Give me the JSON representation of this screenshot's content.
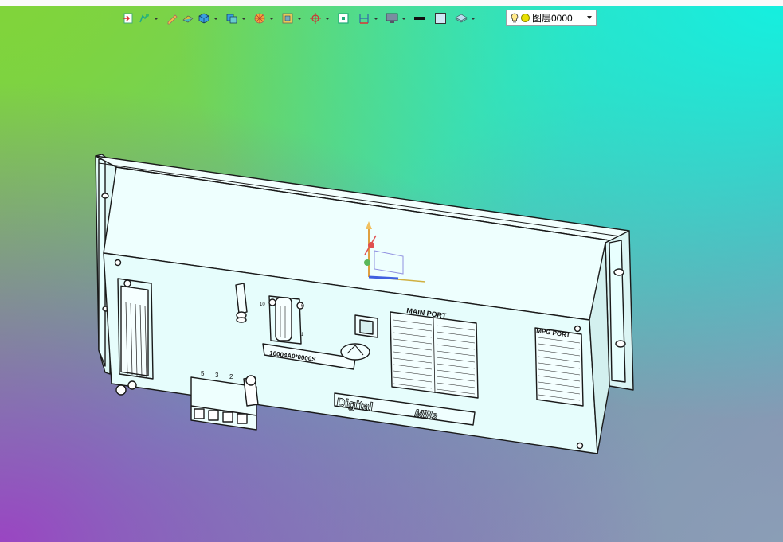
{
  "toolbar": {
    "icons": [
      "import-icon",
      "layer-add-icon",
      "pencil-icon",
      "eraser-block-icon",
      "cube-icon",
      "view-cube-icon",
      "render-wheel-icon",
      "section-box-icon",
      "axis-target-icon",
      "frame-icon",
      "dimension-icon",
      "monitor-icon",
      "line-color-swatch-icon",
      "fill-color-swatch-icon",
      "layers-stack-icon"
    ]
  },
  "layer_selector": {
    "value": "图层0000",
    "bulb_icon": "lightbulb-icon",
    "state_icon": "layer-state-icon"
  },
  "model": {
    "main_port_title": "MAIN PORT",
    "mpg_port_title": "MPG PORT",
    "serial_label": "10004A0*0000S",
    "brand_text": "Digital",
    "brand_suffix": "Mills",
    "pin_labels_top": [
      "5",
      "3",
      "2"
    ],
    "connector_labels": [
      "10",
      "6",
      "1"
    ]
  },
  "colors": {
    "model_fill": "#e8fffe",
    "model_stroke": "#1a1a1a",
    "accent_green": "#7ccf50",
    "accent_cyan": "#14f0e0",
    "accent_purple": "#9a45c2"
  }
}
